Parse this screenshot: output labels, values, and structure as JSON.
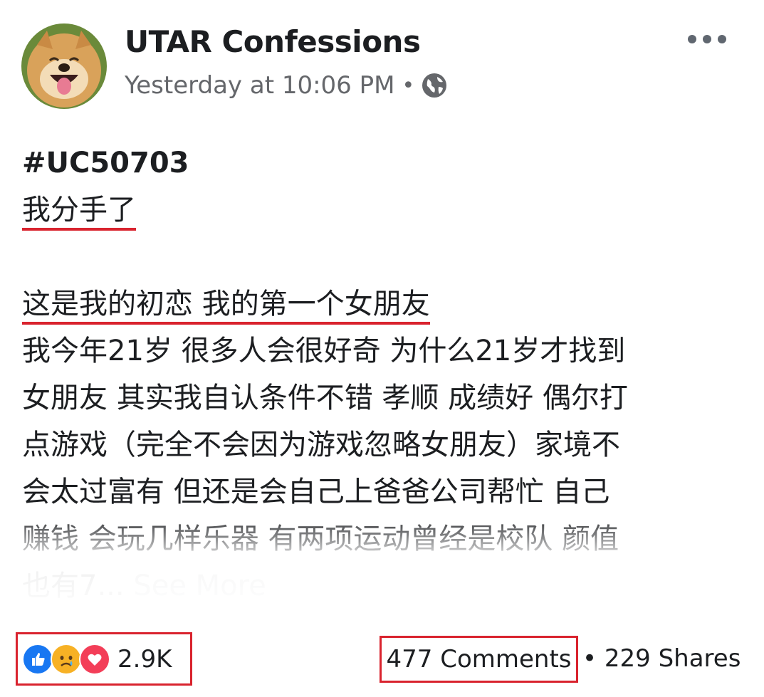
{
  "header": {
    "page_name": "UTAR Confessions",
    "timestamp": "Yesterday at 10:06 PM",
    "separator": "•",
    "privacy_icon": "globe-icon",
    "more_icon": "more-dots-icon"
  },
  "post": {
    "hashtag": "#UC50703",
    "title": "我分手了",
    "lines": [
      "这是我的初恋 我的第一个女朋友",
      "我今年21岁 很多人会很好奇 为什么21岁才找到",
      "女朋友 其实我自认条件不错 孝顺 成绩好 偶尔打",
      "点游戏（完全不会因为游戏忽略女朋友）家境不",
      "会太过富有 但还是会自己上爸爸公司帮忙 自己",
      "赚钱 会玩几样乐器 有两项运动曾经是校队 颜值",
      "也有7..."
    ],
    "see_more": "See More"
  },
  "footer": {
    "reaction_icons": [
      "like-icon",
      "sad-icon",
      "love-icon"
    ],
    "reaction_count": "2.9K",
    "comments": "477 Comments",
    "separator": "•",
    "shares": "229 Shares"
  },
  "colors": {
    "highlight_red": "#d9232e",
    "secondary_text": "#65676b",
    "like_blue": "#1877f2",
    "love_red": "#f33e58",
    "sad_yellow": "#f7b125"
  }
}
